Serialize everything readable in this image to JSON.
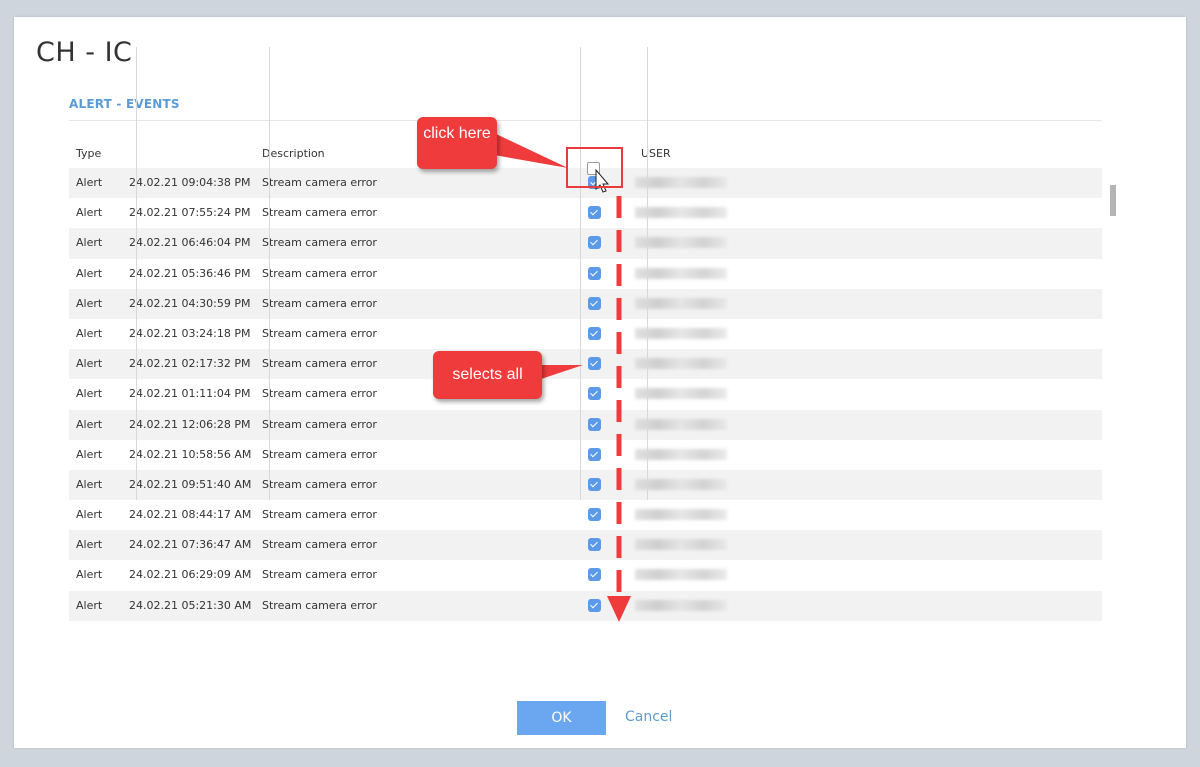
{
  "dialog": {
    "title": "CH - IC",
    "section_title": "ALERT - EVENTS"
  },
  "grid": {
    "headers": {
      "type": "Type",
      "date": "",
      "description": "Description",
      "user": "USER"
    },
    "rows": [
      {
        "type": "Alert",
        "date": "24.02.21 09:04:38 PM",
        "description": "Stream camera error",
        "checked": true
      },
      {
        "type": "Alert",
        "date": "24.02.21 07:55:24 PM",
        "description": "Stream camera error",
        "checked": true
      },
      {
        "type": "Alert",
        "date": "24.02.21 06:46:04 PM",
        "description": "Stream camera error",
        "checked": true
      },
      {
        "type": "Alert",
        "date": "24.02.21 05:36:46 PM",
        "description": "Stream camera error",
        "checked": true
      },
      {
        "type": "Alert",
        "date": "24.02.21 04:30:59 PM",
        "description": "Stream camera error",
        "checked": true
      },
      {
        "type": "Alert",
        "date": "24.02.21 03:24:18 PM",
        "description": "Stream camera error",
        "checked": true
      },
      {
        "type": "Alert",
        "date": "24.02.21 02:17:32 PM",
        "description": "Stream camera error",
        "checked": true
      },
      {
        "type": "Alert",
        "date": "24.02.21 01:11:04 PM",
        "description": "Stream camera error",
        "checked": true
      },
      {
        "type": "Alert",
        "date": "24.02.21 12:06:28 PM",
        "description": "Stream camera error",
        "checked": true
      },
      {
        "type": "Alert",
        "date": "24.02.21 10:58:56 AM",
        "description": "Stream camera error",
        "checked": true
      },
      {
        "type": "Alert",
        "date": "24.02.21 09:51:40 AM",
        "description": "Stream camera error",
        "checked": true
      },
      {
        "type": "Alert",
        "date": "24.02.21 08:44:17 AM",
        "description": "Stream camera error",
        "checked": true
      },
      {
        "type": "Alert",
        "date": "24.02.21 07:36:47 AM",
        "description": "Stream camera error",
        "checked": true
      },
      {
        "type": "Alert",
        "date": "24.02.21 06:29:09 AM",
        "description": "Stream camera error",
        "checked": true
      },
      {
        "type": "Alert",
        "date": "24.02.21 05:21:30 AM",
        "description": "Stream camera error",
        "checked": true
      }
    ]
  },
  "buttons": {
    "ok_label": "OK",
    "cancel_label": "Cancel"
  },
  "annotations": {
    "click_here": "click here",
    "selects_all": "selects all"
  },
  "colors": {
    "accent": "#5b9bd5",
    "checkbox": "#5a9ae8",
    "annotation": "#ef3b3b",
    "ok_button": "#6aa7f0"
  }
}
